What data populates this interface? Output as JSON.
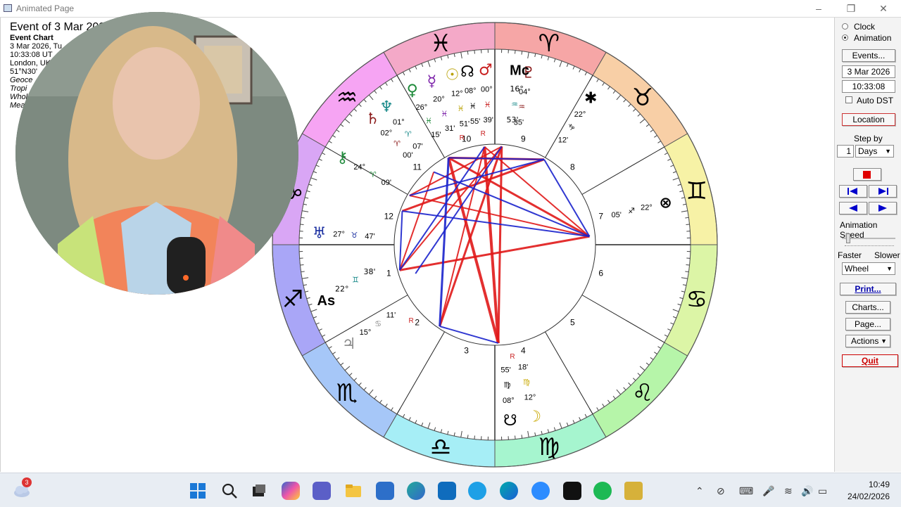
{
  "window": {
    "title": "Animated Page",
    "controls": {
      "minimize": "–",
      "restore": "❐",
      "close": "✕"
    }
  },
  "chart_info": {
    "title": "Event of 3 Mar 2026",
    "subtitle": "Event Chart",
    "lines": [
      "3 Mar 2026, Tu",
      "10:33:08  UT",
      "London, UK",
      "51°N30'"
    ],
    "italic_lines": [
      "Geoce",
      "Tropi",
      "Whol",
      "Mea"
    ]
  },
  "wheel": {
    "zodiac": [
      {
        "glyph": "♓",
        "color": "#f4a9c8"
      },
      {
        "glyph": "♒",
        "color": "#f6a4f3"
      },
      {
        "glyph": "♑",
        "color": "#d9a6f5"
      },
      {
        "glyph": "♐",
        "color": "#a9a6f7"
      },
      {
        "glyph": "♏",
        "color": "#a6c7f8"
      },
      {
        "glyph": "♎",
        "color": "#a6eef6"
      },
      {
        "glyph": "♍",
        "color": "#a6f5cf"
      },
      {
        "glyph": "♌",
        "color": "#b6f5a9"
      },
      {
        "glyph": "♋",
        "color": "#dcf5a6"
      },
      {
        "glyph": "♊",
        "color": "#f7f2a6"
      },
      {
        "glyph": "♉",
        "color": "#f8cfa6"
      },
      {
        "glyph": "♈",
        "color": "#f6a6a6"
      }
    ],
    "houses": [
      "1",
      "2",
      "3",
      "4",
      "5",
      "6",
      "7",
      "8",
      "9",
      "10",
      "11",
      "12"
    ],
    "angles": {
      "ascendant": "As",
      "midheaven": "Mc"
    },
    "planets": [
      {
        "glyph": "♅",
        "color": "#1a2fa0",
        "deg": "27°",
        "sign": "♉",
        "min": "47'"
      },
      {
        "glyph": "⚷",
        "color": "#1e8a3a",
        "deg": "24°",
        "sign": "♈",
        "min": "09'"
      },
      {
        "glyph": "♄",
        "color": "#8b1b1b",
        "deg": "02°",
        "sign": "♈",
        "min": "00'"
      },
      {
        "glyph": "♆",
        "color": "#1a8a8a",
        "deg": "01°",
        "sign": "♈",
        "min": "07'"
      },
      {
        "glyph": "♀",
        "color": "#1e8a3a",
        "deg": "26°",
        "sign": "♓",
        "min": "15'"
      },
      {
        "glyph": "☿",
        "color": "#7a1ea8",
        "deg": "20°",
        "sign": "♓",
        "min": "31'"
      },
      {
        "glyph": "☉",
        "color": "#b8a000",
        "deg": "12°",
        "sign": "♓",
        "min": "51'"
      },
      {
        "glyph": "☊",
        "color": "#000000",
        "deg": "08°",
        "sign": "♓",
        "min": "55'"
      },
      {
        "glyph": "♂",
        "color": "#c81e1e",
        "deg": "00°",
        "sign": "♓",
        "min": "39'"
      },
      {
        "glyph": "♇",
        "color": "#8b1b1b",
        "deg": "04°",
        "sign": "♒",
        "min": "35'"
      },
      {
        "glyph": "✱",
        "color": "#000000",
        "deg": "22°",
        "sign": "♑",
        "min": "12'"
      },
      {
        "glyph": "⊗",
        "color": "#000000",
        "deg": "22°",
        "sign": "♐",
        "min": "05'"
      },
      {
        "glyph": "♃",
        "color": "#888888",
        "deg": "15°",
        "sign": "♋",
        "min": "11'"
      },
      {
        "glyph": "☋",
        "color": "#000000",
        "deg": "08°",
        "sign": "♍",
        "min": "55'"
      },
      {
        "glyph": "☽",
        "color": "#c8a800",
        "deg": "12°",
        "sign": "♍",
        "min": "18'"
      }
    ],
    "mc_reading": {
      "deg": "16°",
      "sign": "♒",
      "min": "53'"
    },
    "as_reading": {
      "deg": "22°",
      "sign": "♊",
      "min": "38'"
    },
    "retro": "R"
  },
  "panel": {
    "clock_label": "Clock",
    "animation_label": "Animation",
    "events_label": "Events...",
    "date_value": "3 Mar 2026",
    "time_value": "10:33:08",
    "auto_dst_label": "Auto DST",
    "location_label": "Location",
    "step_by_label": "Step by",
    "step_value": "1",
    "step_unit": "Days",
    "animation_speed_label": "Animation Speed",
    "faster_label": "Faster",
    "slower_label": "Slower",
    "mode_value": "Wheel",
    "print_label": "Print...",
    "charts_label": "Charts...",
    "page_label": "Page...",
    "actions_label": "Actions",
    "quit_label": "Quit",
    "colors": {
      "stop": "#e00000",
      "nav": "#0000cc",
      "quit": "#cc0000",
      "location_border": "#cc0000"
    }
  },
  "taskbar": {
    "weather_badge": "3",
    "time": "10:49",
    "date": "24/02/2026",
    "apps": [
      "windows-start",
      "search",
      "task-view",
      "copilot",
      "teams",
      "file-explorer",
      "microsoft-store",
      "edge-dev",
      "outlook",
      "skype",
      "edge",
      "zoom",
      "capcut",
      "spotify",
      "astro-app"
    ]
  }
}
